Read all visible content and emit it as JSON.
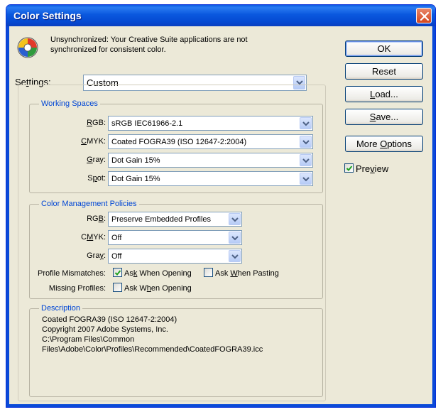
{
  "window": {
    "title": "Color Settings"
  },
  "message": "Unsynchronized: Your Creative Suite applications are not synchronized for consistent color.",
  "settings": {
    "label": "Settings:",
    "value": "Custom"
  },
  "working_spaces": {
    "title": "Working Spaces",
    "rgb": {
      "label": "RGB:",
      "value": "sRGB IEC61966-2.1"
    },
    "cmyk": {
      "label": "CMYK:",
      "value": "Coated FOGRA39 (ISO 12647-2:2004)"
    },
    "gray": {
      "label": "Gray:",
      "value": "Dot Gain 15%"
    },
    "spot": {
      "label": "Spot:",
      "value": "Dot Gain 15%"
    }
  },
  "policies": {
    "title": "Color Management Policies",
    "rgb": {
      "label": "RGB:",
      "value": "Preserve Embedded Profiles"
    },
    "cmyk": {
      "label": "CMYK:",
      "value": "Off"
    },
    "gray": {
      "label": "Gray:",
      "value": "Off"
    },
    "mismatch_label": "Profile Mismatches:",
    "ask_opening": {
      "label": "Ask When Opening",
      "checked": true
    },
    "ask_pasting": {
      "label": "Ask When Pasting",
      "checked": false
    },
    "missing_label": "Missing Profiles:",
    "missing_ask_opening": {
      "label": "Ask When Opening",
      "checked": false
    }
  },
  "description": {
    "title": "Description",
    "lines": [
      "Coated FOGRA39 (ISO 12647-2:2004)",
      "Copyright 2007 Adobe Systems, Inc.",
      "C:\\Program Files\\Common",
      "Files\\Adobe\\Color\\Profiles\\Recommended\\CoatedFOGRA39.icc"
    ]
  },
  "buttons": {
    "ok": "OK",
    "reset": "Reset",
    "load": "Load...",
    "save": "Save...",
    "more_options": "More Options"
  },
  "preview": {
    "label": "Preview",
    "checked": true
  },
  "colors": {
    "title_bar": "#0a58de",
    "accent_label": "#0046d5",
    "dialog_bg": "#ece9d8"
  }
}
